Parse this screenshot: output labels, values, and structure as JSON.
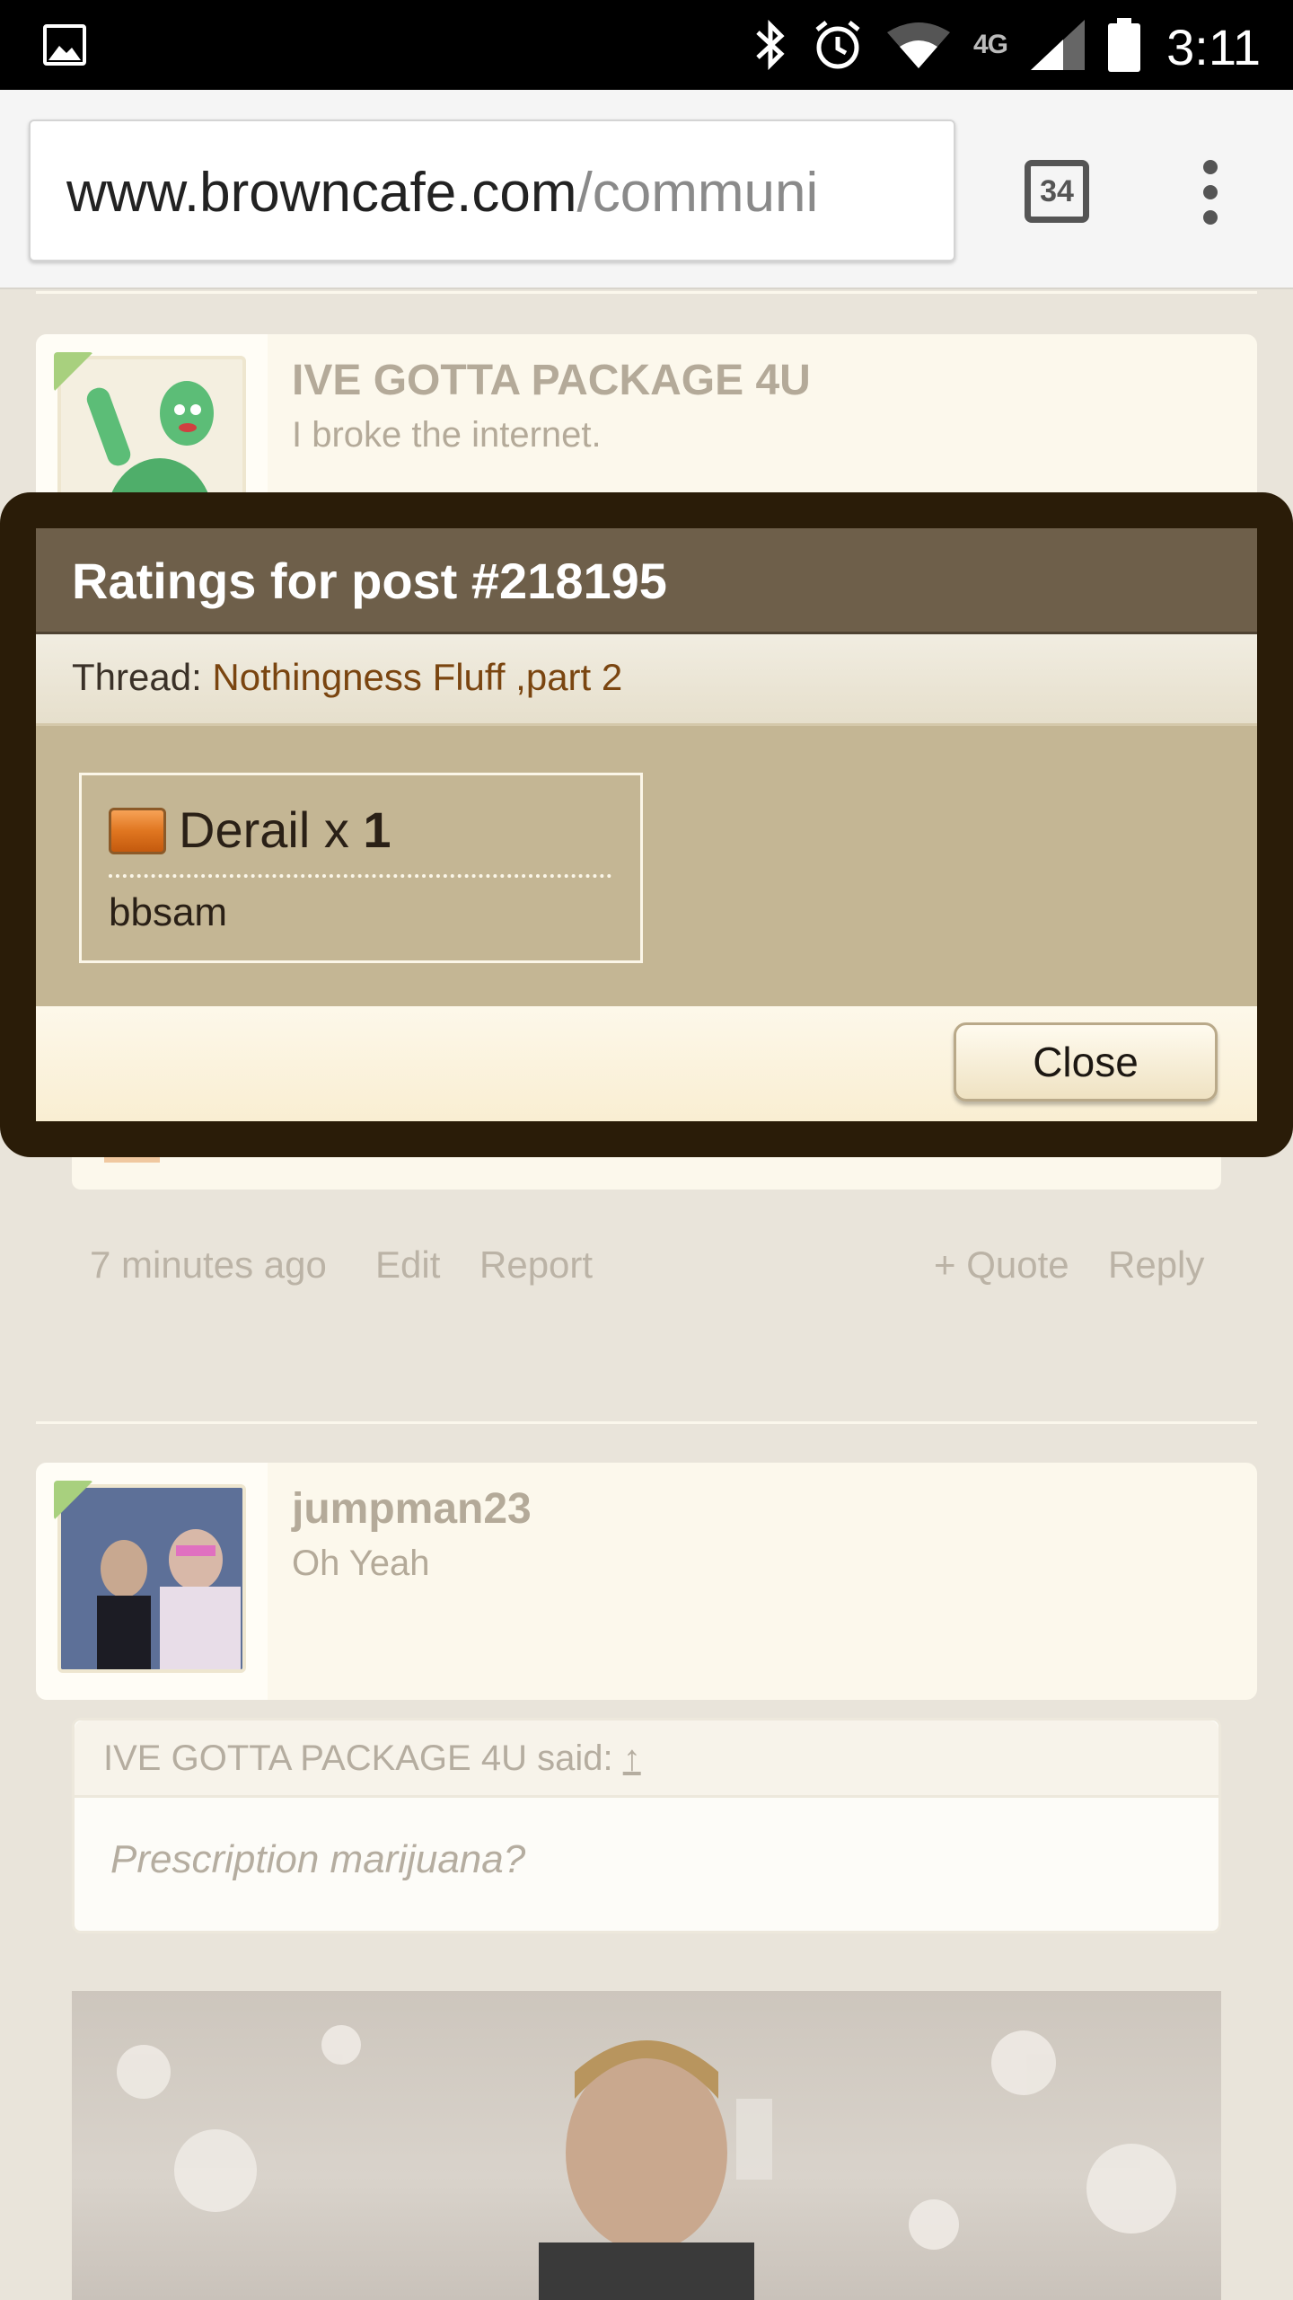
{
  "status_bar": {
    "time": "3:11",
    "network": "4G",
    "icons": [
      "gallery-icon",
      "bluetooth-icon",
      "alarm-icon",
      "wifi-icon",
      "signal-icon",
      "battery-icon"
    ]
  },
  "browser": {
    "url_host": "www.browncafe.com",
    "url_path": "/communi",
    "tab_count": "34"
  },
  "posts": [
    {
      "username": "IVE GOTTA PACKAGE 4U",
      "user_title": "I broke the internet."
    },
    {
      "username": "jumpman23",
      "user_title": "Oh Yeah",
      "quote": {
        "author_line": "IVE GOTTA PACKAGE 4U said:",
        "arrow": "↑",
        "text": "Prescription marijuana?"
      }
    }
  ],
  "post_actions": {
    "time_ago": "7 minutes ago",
    "edit": "Edit",
    "report": "Report",
    "quote": "+ Quote",
    "reply": "Reply"
  },
  "dialog": {
    "title": "Ratings for post #218195",
    "thread_label": "Thread:",
    "thread_name": "Nothingness Fluff ,part 2",
    "rating": {
      "name": "Derail",
      "x": "x",
      "count": "1",
      "users": [
        "bbsam"
      ]
    },
    "close_label": "Close"
  },
  "colors": {
    "overlay_frame": "#2a1c08",
    "dialog_header": "#6e5f4a",
    "dialog_body": "#c4b694",
    "thread_link": "#7a4510"
  }
}
